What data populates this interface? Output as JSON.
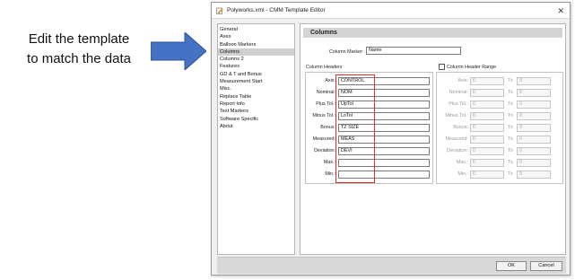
{
  "annotation": {
    "line1": "Edit the template",
    "line2": "to match the data",
    "arrow_color": "#4472c4"
  },
  "window": {
    "title": "Polyworks.xml - CMM Template Editor",
    "close_glyph": "✕"
  },
  "nav": {
    "items": [
      "General",
      "Axes",
      "Balloon Markers",
      "Columns",
      "Columns 2",
      "Features",
      "GD & T and Bonus",
      "Measurement Start",
      "Misc.",
      "Replace Table",
      "Report Info",
      "Text Markers",
      "Software Specific",
      "About"
    ],
    "selected": "Columns"
  },
  "panel": {
    "title": "Columns",
    "column_marker_label": "Column Marker:",
    "column_marker_value": "Name",
    "headers_group_title": "Column Headers",
    "range_checkbox_label": "Column Header Range",
    "rows": [
      {
        "label": "Axis:",
        "value": "CONTROL"
      },
      {
        "label": "Nominal:",
        "value": "NOM"
      },
      {
        "label": "Plus Tol.:",
        "value": "UpTol"
      },
      {
        "label": "Minus Tol.:",
        "value": "LoTol"
      },
      {
        "label": "Bonus:",
        "value": "TZ SIZE"
      },
      {
        "label": "Measured:",
        "value": "MEAS"
      },
      {
        "label": "Deviation:",
        "value": "DEVI"
      },
      {
        "label": "Max.:",
        "value": ""
      },
      {
        "label": "Min.:",
        "value": ""
      }
    ],
    "range_rows": [
      {
        "label": "Axis:",
        "from": "0",
        "to_label": "To",
        "to": "0"
      },
      {
        "label": "Nominal:",
        "from": "0",
        "to_label": "To",
        "to": "0"
      },
      {
        "label": "Plus Tol.:",
        "from": "0",
        "to_label": "To",
        "to": "0"
      },
      {
        "label": "Minus Tol.:",
        "from": "0",
        "to_label": "To",
        "to": "0"
      },
      {
        "label": "Bonus:",
        "from": "0",
        "to_label": "To",
        "to": "0"
      },
      {
        "label": "Measured:",
        "from": "0",
        "to_label": "To",
        "to": "0"
      },
      {
        "label": "Deviation:",
        "from": "0",
        "to_label": "To",
        "to": "0"
      },
      {
        "label": "Max.:",
        "from": "0",
        "to_label": "To",
        "to": "0"
      },
      {
        "label": "Min.:",
        "from": "0",
        "to_label": "To",
        "to": "0"
      }
    ],
    "highlight_color": "#e0302b"
  },
  "buttons": {
    "ok": "OK",
    "cancel": "Cancel"
  }
}
